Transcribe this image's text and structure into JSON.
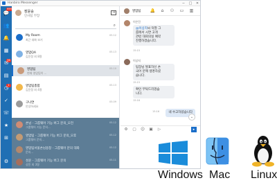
{
  "window": {
    "title": "Hanbiro Messenger",
    "minimize": "−",
    "maximize": "□",
    "close": "✕"
  },
  "sidebar": {
    "buttons": [
      "chat-icon",
      "users-icon",
      "bell-icon",
      "calendar-icon",
      "mail-icon",
      "doc-icon",
      "clock-icon",
      "check-icon",
      "phone-icon",
      "bookmark-icon",
      "grid-icon",
      "gear-icon"
    ],
    "badges": [
      "999",
      "36",
      "1"
    ]
  },
  "profile": {
    "name": "장윤숭",
    "status": "인사팀 부장",
    "logout_icon": "⇥"
  },
  "search": {
    "placeholder": "",
    "icon": "⌕"
  },
  "chats": [
    {
      "name": "My Room",
      "sub": "최근 대화 보기",
      "time": "05.12",
      "count": "",
      "color": "#1b6ec9"
    },
    {
      "name": "영업QA",
      "sub": "김윤정 외 8명",
      "time": "05.13",
      "count": "",
      "color": "#7fb2e5"
    },
    {
      "name": "영업팀",
      "sub": "현재 영업팀이 ...",
      "time": "05.10",
      "count": "",
      "color": "#c99b7c",
      "selected": true
    },
    {
      "name": "영업팀총합",
      "sub": "김윤정 외 4명",
      "time": "05.13",
      "count": "",
      "color": "#f2b84b"
    },
    {
      "name": "구나연",
      "sub": "안녕하세요",
      "time": "05.09",
      "count": "",
      "color": "#9b9b9b"
    }
  ],
  "dim_chats": [
    {
      "name": "손님 - 그룹웨어 기능 버그 문의_오전",
      "sub": "그룹웨어 기능 문의...",
      "time": "05.12",
      "color": "#e48e6e"
    },
    {
      "name": "영업팀 - 그룹웨어 기능 버그 문의_오후",
      "sub": "그룹웨어 문의...",
      "time": "05.12",
      "color": "#d6a06e"
    },
    {
      "name": "영업팀서울손님용창 - 그룹웨어 문의 대화",
      "sub": "문의...",
      "time": "05.12",
      "color": "#c28a66"
    },
    {
      "name": "성윤 - 그룹웨어 기능 버그 문의",
      "sub": "성윤 외 3명",
      "time": "05.11",
      "color": "#b36b52"
    }
  ],
  "conversation": {
    "title": "영업팀",
    "head_icons": [
      "bell-icon",
      "chat-icon",
      "person-add-icon",
      "folder-icon",
      "layout-icon"
    ],
    "messages": [
      {
        "sender": "이은진",
        "mention": "@이상지",
        "text": "씨 덕열 그\n룹에서 시연 고객\n관련 대회의실 예약\n진행하겠습니다.",
        "time": "15:15",
        "color": "#b3856a"
      },
      {
        "sender": "이상지",
        "mention": "",
        "text": "팀장님 발표하신 손\n국어 분께 생명하셨\n습니다.",
        "time": "15:15",
        "color": "#8a6a5a"
      },
      {
        "sender": "",
        "mention": "",
        "text": "확인 부탁드리겠습\n니다.",
        "time": "15:16",
        "color": ""
      }
    ],
    "mine": {
      "text": "네 수고하셨습니다",
      "time": "15:16"
    },
    "scroll_icon": "⌄",
    "composer_placeholder": "",
    "composer_tools": [
      "settings-icon",
      "attach-icon",
      "emoji-icon",
      "image-icon",
      "video-icon"
    ],
    "send_icon": "▸"
  },
  "platforms": [
    {
      "name": "Windows",
      "color": "#1a8cda"
    },
    {
      "name": "Mac",
      "color": "#3d8fe3"
    },
    {
      "name": "Linux",
      "color": "#111111"
    }
  ]
}
